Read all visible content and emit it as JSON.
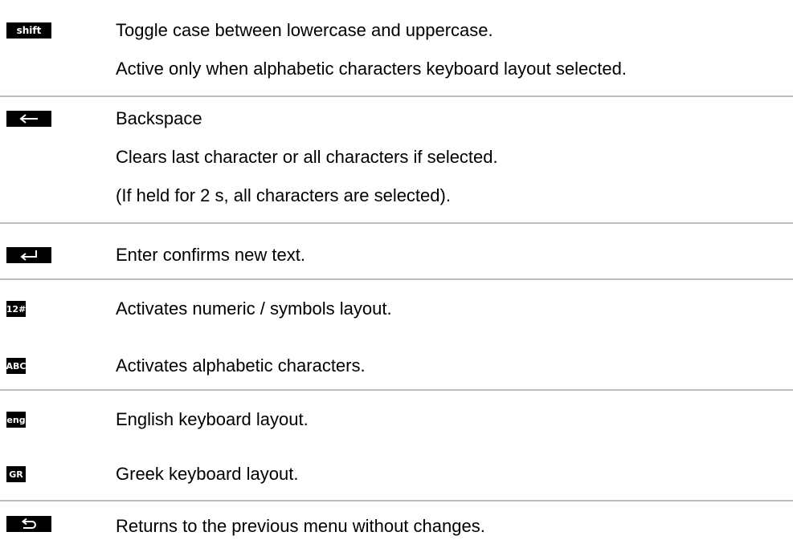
{
  "entries": [
    {
      "key_label": "shift",
      "key_icon": "shift-key-icon",
      "lines": [
        "Toggle case between lowercase and uppercase.",
        "Active only when alphabetic characters keyboard layout selected."
      ]
    },
    {
      "key_label": "",
      "key_icon": "backspace-arrow-icon",
      "lines": [
        "Backspace",
        "Clears last character or all characters if selected.",
        "(If held for 2 s, all characters are selected)."
      ]
    },
    {
      "key_label": "",
      "key_icon": "enter-return-icon",
      "lines": [
        "Enter confirms new text."
      ]
    },
    {
      "key_label": "12#",
      "key_icon": "numeric-layout-icon",
      "lines": [
        "Activates numeric / symbols layout."
      ]
    },
    {
      "key_label": "ABC",
      "key_icon": "alphabetic-layout-icon",
      "lines": [
        "Activates alphabetic characters."
      ]
    },
    {
      "key_label": "eng",
      "key_icon": "english-layout-icon",
      "lines": [
        "English keyboard layout."
      ]
    },
    {
      "key_label": "GR",
      "key_icon": "greek-layout-icon",
      "lines": [
        "Greek keyboard layout."
      ]
    },
    {
      "key_label": "",
      "key_icon": "back-return-icon",
      "lines": [
        "Returns to the previous menu without changes."
      ]
    }
  ],
  "colors": {
    "key_background": "#000000",
    "key_text": "#ffffff",
    "separator": "#bdbdbd",
    "text": "#000000"
  }
}
